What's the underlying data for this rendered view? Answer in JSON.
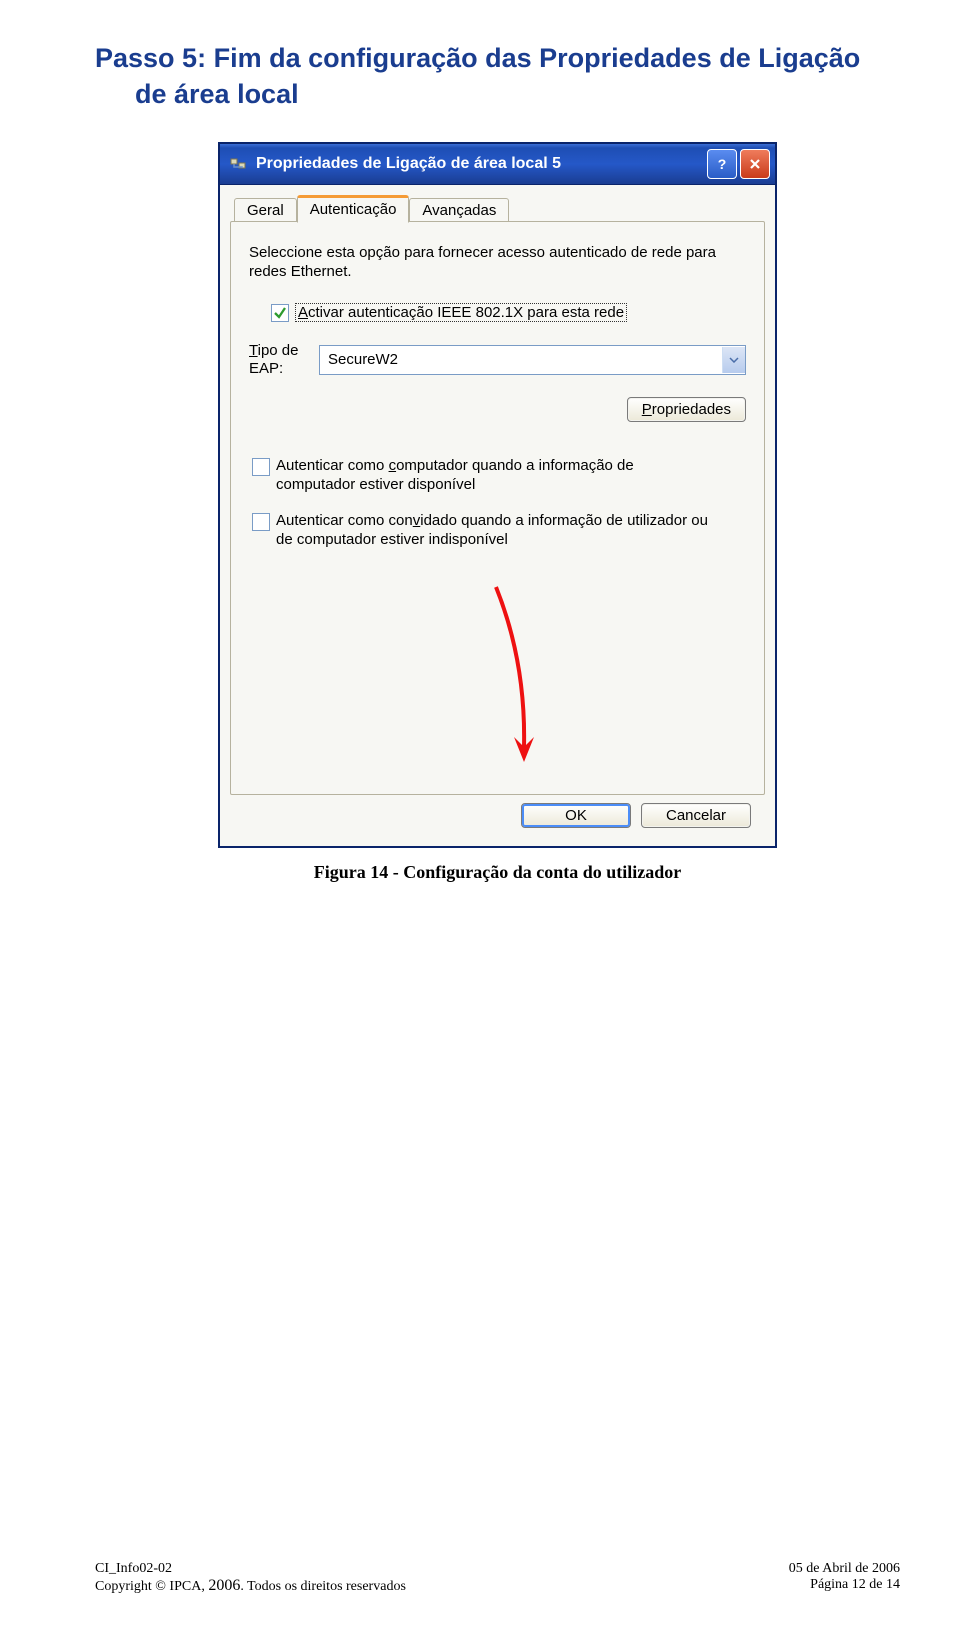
{
  "heading": {
    "step": "Passo 5:",
    "title": "Fim da configuração das Propriedades de Ligação",
    "subtitle": "de área local"
  },
  "dialog": {
    "title": "Propriedades de Ligação de área local 5",
    "tabs": {
      "geral": "Geral",
      "autenticacao": "Autenticação",
      "avancadas": "Avançadas"
    },
    "intro": "Seleccione esta opção para fornecer acesso autenticado de rede para redes Ethernet.",
    "activate_prefix_accessA": "A",
    "activate_label": "ctivar autenticação IEEE 802.1X para esta rede",
    "eap": {
      "label_line1_accessT": "T",
      "label_line1_rest": "ipo de",
      "label_line2": "EAP:",
      "value": "SecureW2"
    },
    "prop_btn_accessP": "P",
    "prop_btn_rest": "ropriedades",
    "checkbox2_line1_pre": "Autenticar como ",
    "checkbox2_line1_accessC": "c",
    "checkbox2_line1_post": "omputador quando a informação de",
    "checkbox2_line2": "computador estiver disponível",
    "checkbox3_line1_pre": "Autenticar como con",
    "checkbox3_line1_accessV": "v",
    "checkbox3_line1_post": "idado quando a informação de utilizador ou",
    "checkbox3_line2": "de computador estiver indisponível",
    "ok": "OK",
    "cancel": "Cancelar"
  },
  "caption": "Figura 14 - Configuração da conta do utilizador",
  "footer": {
    "left1": "CI_Info02-02",
    "right1": "05 de Abril de 2006",
    "left2_pre": "Copyright © IPCA, ",
    "left2_year": "2006",
    "left2_post": ". Todos os direitos reservados",
    "right2": "Página 12 de 14"
  }
}
